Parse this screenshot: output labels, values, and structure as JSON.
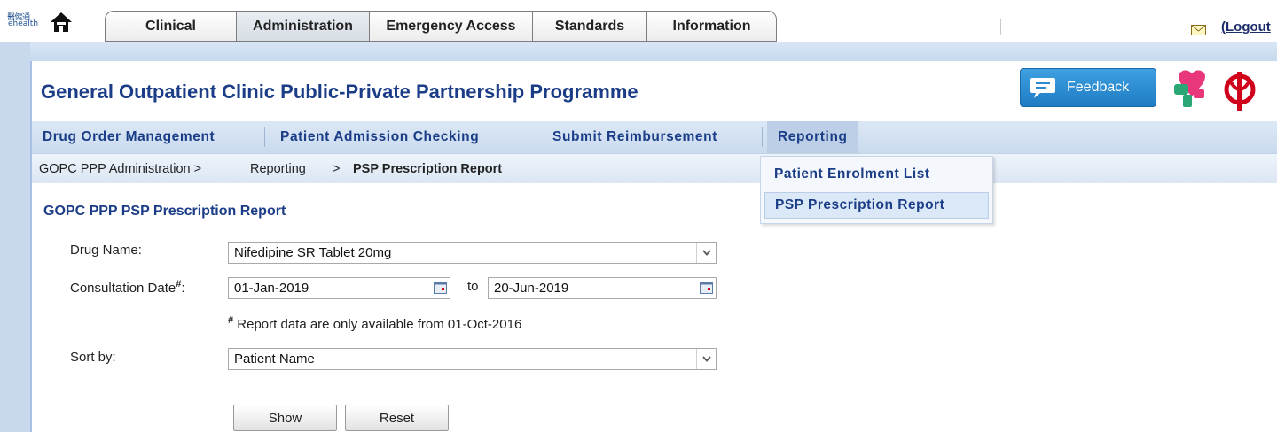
{
  "topbar": {
    "logo_cn": "醫健通",
    "logo_en": "ehealth",
    "tabs": [
      {
        "label": "Clinical",
        "active": false
      },
      {
        "label": "Administration",
        "active": true
      },
      {
        "label": "Emergency Access",
        "active": false
      },
      {
        "label": "Standards",
        "active": false
      },
      {
        "label": "Information",
        "active": false
      }
    ],
    "logout_label": "(Logout"
  },
  "header": {
    "title": "General Outpatient Clinic Public-Private Partnership Programme",
    "feedback_label": "Feedback"
  },
  "subnav": {
    "items": [
      {
        "label": "Drug Order Management"
      },
      {
        "label": "Patient Admission Checking"
      },
      {
        "label": "Submit Reimbursement"
      },
      {
        "label": "Reporting",
        "active": true
      }
    ]
  },
  "breadcrumb": {
    "root": "GOPC PPP Administration >",
    "middle": "Reporting",
    "sep": ">",
    "current": "PSP Prescription Report"
  },
  "reporting_menu": {
    "items": [
      {
        "label": "Patient Enrolment List"
      },
      {
        "label": "PSP Prescription Report",
        "hover": true
      }
    ]
  },
  "form": {
    "section_title": "GOPC PPP PSP Prescription Report",
    "drug_name_label": "Drug Name:",
    "drug_name_value": "Nifedipine SR Tablet 20mg",
    "consultation_date_label": "Consultation Date",
    "consultation_date_mark": "#",
    "consultation_date_colon": ":",
    "date_from": "01-Jan-2019",
    "to_label": "to",
    "date_to": "20-Jun-2019",
    "note_mark": "#",
    "note_text": " Report data are only available from 01-Oct-2016",
    "sort_by_label": "Sort by:",
    "sort_by_value": "Patient Name",
    "show_label": "Show",
    "reset_label": "Reset"
  },
  "colors": {
    "brand_blue": "#1b3d87",
    "nav_band": "#cadbef",
    "feedback_button": "#2a8bd3",
    "ha_logo_pink": "#e8377a",
    "ha_logo_red": "#d0021b",
    "ha_logo_green": "#2aa775"
  },
  "icons": {
    "home": "home-icon",
    "mail": "mail-icon",
    "feedback": "speech-bubble-icon",
    "calendar": "calendar-icon",
    "select_arrow": "chevron-down-icon"
  }
}
